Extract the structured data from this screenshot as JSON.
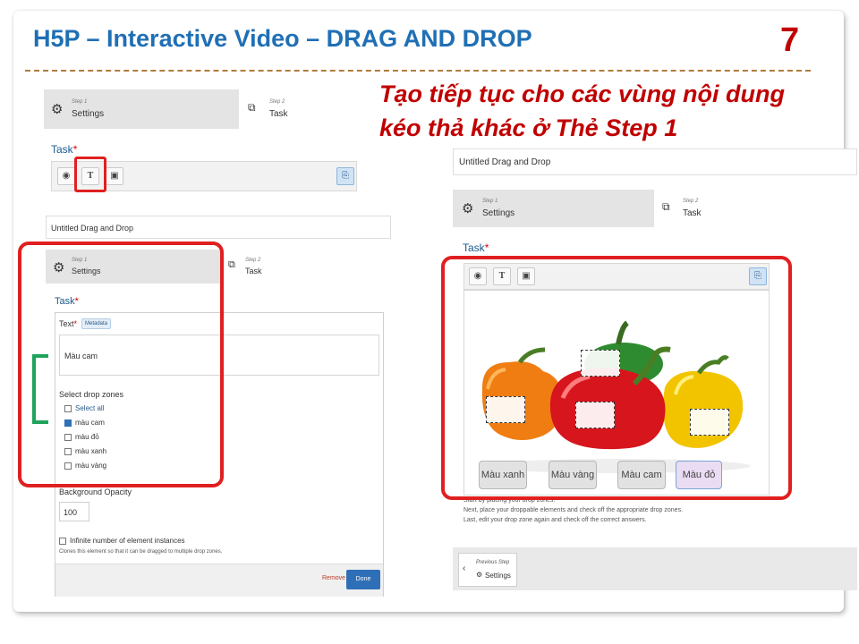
{
  "slide": {
    "title": "H5P – Interactive Video – DRAG AND DROP",
    "number": "7",
    "caption_line1": "Tạo tiếp tục cho các vùng nội dung",
    "caption_line2": "kéo thả khác ở Thẻ Step 1",
    "accent_color": "#1f6fb5",
    "number_color": "#c00000"
  },
  "editor_top": {
    "step1_no": "Step 1",
    "step1_name": "Settings",
    "step2_no": "Step 2",
    "step2_name": "Task",
    "task_label": "Task",
    "required": "*"
  },
  "editor_left": {
    "title_value": "Untitled Drag and Drop",
    "step1_no": "Step 1",
    "step1_name": "Settings",
    "step2_no": "Step 2",
    "step2_name": "Task",
    "task_label": "Task",
    "required": "*",
    "text_label": "Text",
    "metadata_btn": "Metadata",
    "text_value": "Màu cam",
    "drop_zones_label": "Select drop zones",
    "select_all": "Select all",
    "zones": [
      {
        "label": "màu cam",
        "checked": true
      },
      {
        "label": "màu đỏ",
        "checked": false
      },
      {
        "label": "màu xanh",
        "checked": false
      },
      {
        "label": "màu vàng",
        "checked": false
      }
    ],
    "bg_opacity_label": "Background Opacity",
    "bg_opacity_value": "100",
    "infinite_label": "Infinite number of element instances",
    "infinite_help": "Clones this element so that it can be dragged to multiple drop zones.",
    "remove_btn": "Remove",
    "done_btn": "Done"
  },
  "editor_right": {
    "title_value": "Untitled Drag and Drop",
    "step1_no": "Step 1",
    "step1_name": "Settings",
    "step2_no": "Step 2",
    "step2_name": "Task",
    "task_label": "Task",
    "required": "*",
    "drag_items": [
      "Màu xanh",
      "Màu vàng",
      "Màu cam",
      "Màu đỏ"
    ],
    "help_line1": "Start by placing your drop zones.",
    "help_line2": "Next, place your droppable elements and check off the appropriate drop zones.",
    "help_line3": "Last, edit your drop zone again and check off the correct answers.",
    "prev_step_label": "Previous Step",
    "prev_step_name": "Settings"
  }
}
